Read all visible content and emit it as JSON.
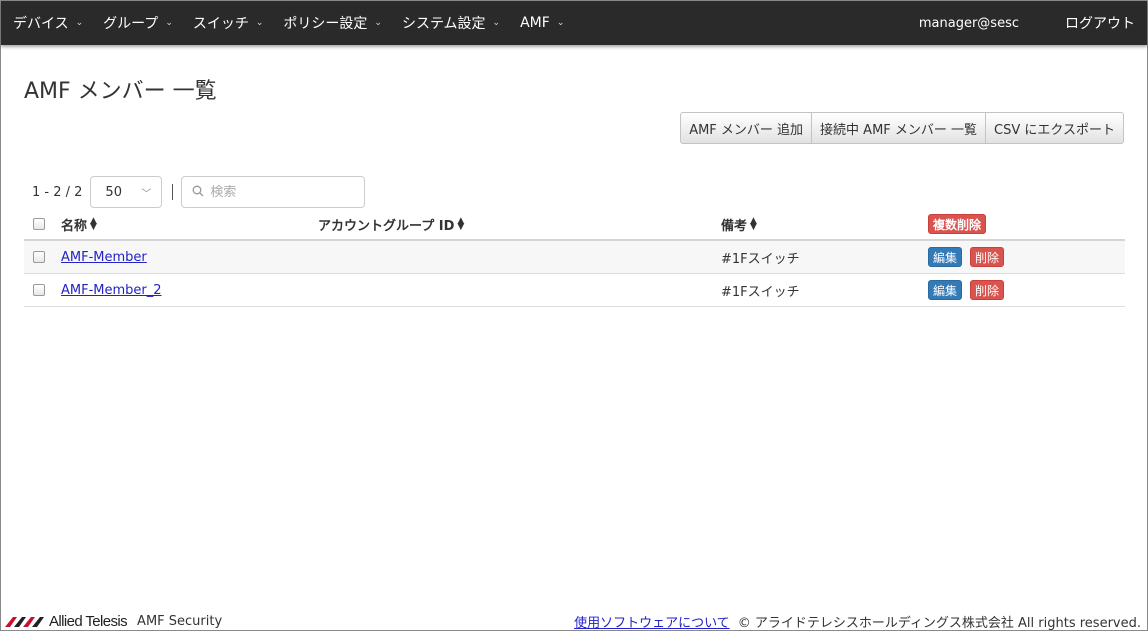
{
  "nav": {
    "items": [
      {
        "label": "デバイス"
      },
      {
        "label": "グループ"
      },
      {
        "label": "スイッチ"
      },
      {
        "label": "ポリシー設定"
      },
      {
        "label": "システム設定"
      },
      {
        "label": "AMF"
      }
    ],
    "user": "manager@sesc",
    "logout": "ログアウト",
    "caret_glyph": "⌄"
  },
  "page": {
    "title": "AMF メンバー 一覧"
  },
  "actions": {
    "add": "AMF メンバー 追加",
    "connected_list": "接続中 AMF メンバー 一覧",
    "export_csv": "CSV にエクスポート"
  },
  "toolbar": {
    "count": "1 - 2 / 2",
    "page_size": "50",
    "divider": "|",
    "search_placeholder": "検索"
  },
  "table": {
    "headers": {
      "name": "名称",
      "account_group_id": "アカウントグループ ID",
      "note": "備考",
      "bulk_delete": "複数削除"
    },
    "rows": [
      {
        "name": "AMF-Member",
        "account_group_id": "",
        "note": "#1Fスイッチ",
        "edit": "編集",
        "delete": "削除"
      },
      {
        "name": "AMF-Member_2",
        "account_group_id": "",
        "note": "#1Fスイッチ",
        "edit": "編集",
        "delete": "削除"
      }
    ]
  },
  "footer": {
    "brand": "Allied Telesis",
    "product": "AMF Security",
    "software_link": "使用ソフトウェアについて",
    "copyright": "© アライドテレシスホールディングス株式会社 All rights reserved."
  },
  "colors": {
    "navbar_bg": "#2a2a2a",
    "danger": "#d9534f",
    "primary": "#337ab7",
    "logo_red": "#c8102e"
  }
}
